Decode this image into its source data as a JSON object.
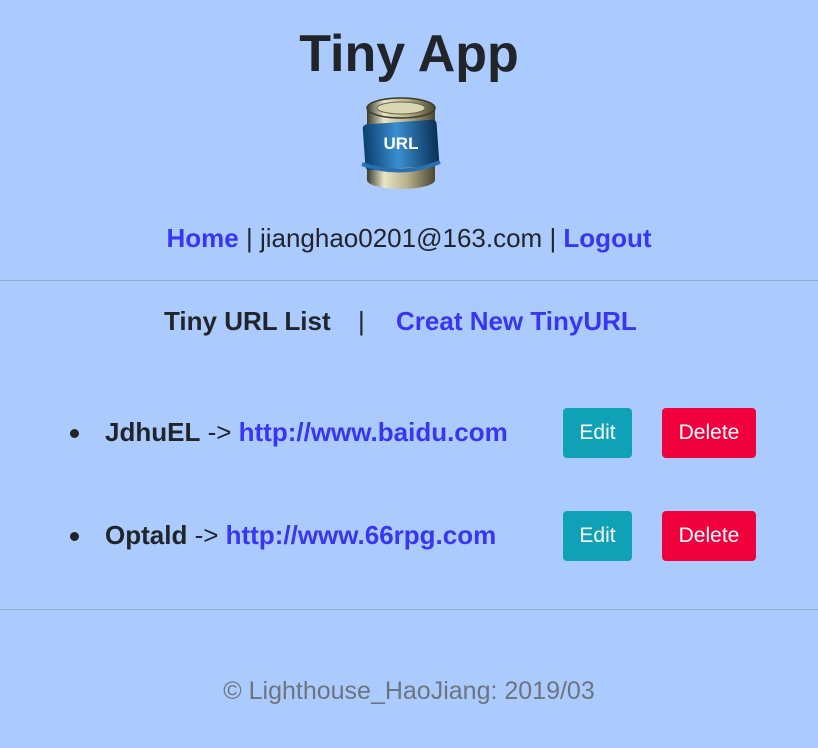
{
  "app": {
    "title": "Tiny App"
  },
  "logo": {
    "text": "URL"
  },
  "nav": {
    "home": "Home",
    "sep1": " | ",
    "email": "jianghao0201@163.com",
    "sep2": " | ",
    "logout": "Logout"
  },
  "tabs": {
    "list": "Tiny URL List",
    "separator": "|",
    "create": "Creat New TinyURL"
  },
  "urls": [
    {
      "short": "JdhuEL",
      "arrow": " -> ",
      "long": "http://www.baidu.com",
      "edit": "Edit",
      "delete": "Delete"
    },
    {
      "short": "Optald",
      "arrow": " -> ",
      "long": "http://www.66rpg.com",
      "edit": "Edit",
      "delete": "Delete"
    }
  ],
  "footer": "© Lighthouse_HaoJiang: 2019/03",
  "colors": {
    "background": "#abcbfe",
    "link": "#3936f2",
    "edit": "#0fa2b6",
    "delete": "#f0003c"
  }
}
